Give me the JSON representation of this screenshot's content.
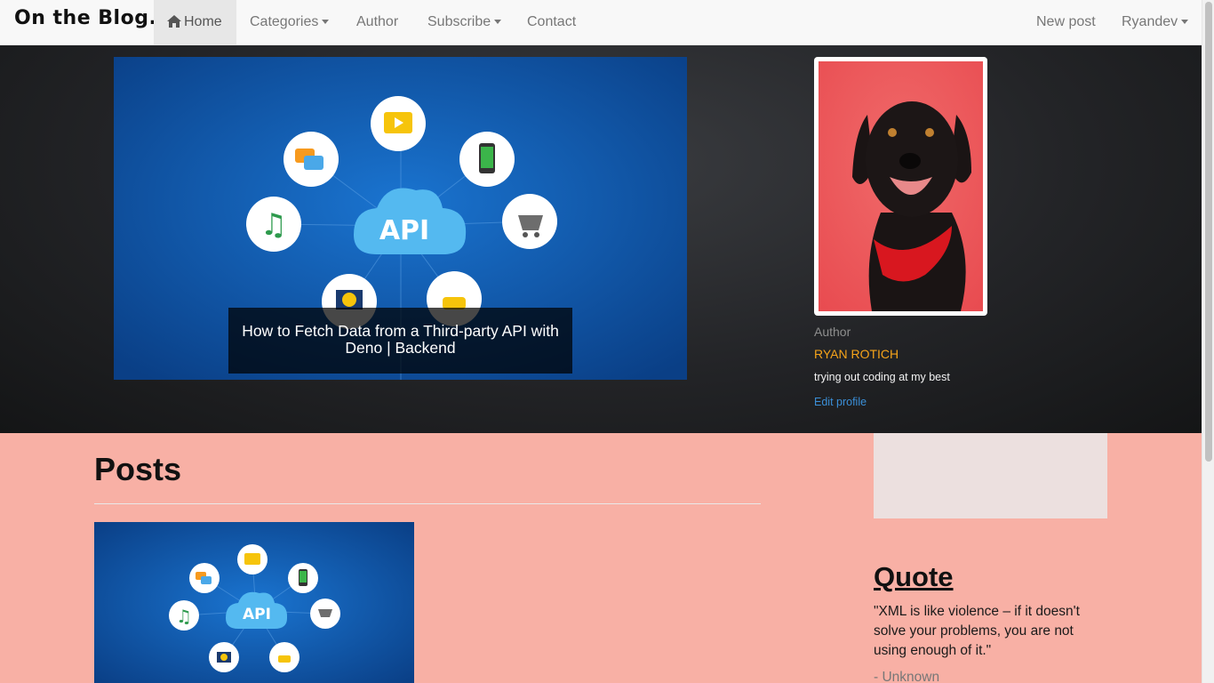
{
  "navbar": {
    "brand": "On the Blog.",
    "items": [
      {
        "label": "Home",
        "icon": "home-icon",
        "active": true
      },
      {
        "label": "Categories",
        "dropdown": true
      },
      {
        "label": "Author"
      },
      {
        "label": "Subscribe",
        "dropdown": true
      },
      {
        "label": "Contact"
      }
    ],
    "right_items": [
      {
        "label": "New post"
      },
      {
        "label": "Ryandev",
        "dropdown": true
      }
    ]
  },
  "hero": {
    "caption_line1": "How to Fetch Data from a Third-party API with",
    "caption_line2": "Deno | Backend",
    "image_icon": "api-cloud-illustration",
    "image_text": "API"
  },
  "profile": {
    "label": "Author",
    "name": "RYAN ROTICH",
    "bio": "trying out coding at my best",
    "edit_label": "Edit profile",
    "photo_icon": "dog-photo"
  },
  "posts": {
    "title": "Posts",
    "thumb_text": "API"
  },
  "sidebar": {
    "quote_title": "Quote",
    "quote_text": "\"XML is like violence – if it doesn't solve your problems, you are not using enough of it.\"",
    "quote_author": "- Unknown"
  },
  "colors": {
    "page_bg": "#f8b0a5",
    "author_name": "#f5a31a",
    "link": "#3b8fd8",
    "hero_blue": "#0b58a8"
  }
}
